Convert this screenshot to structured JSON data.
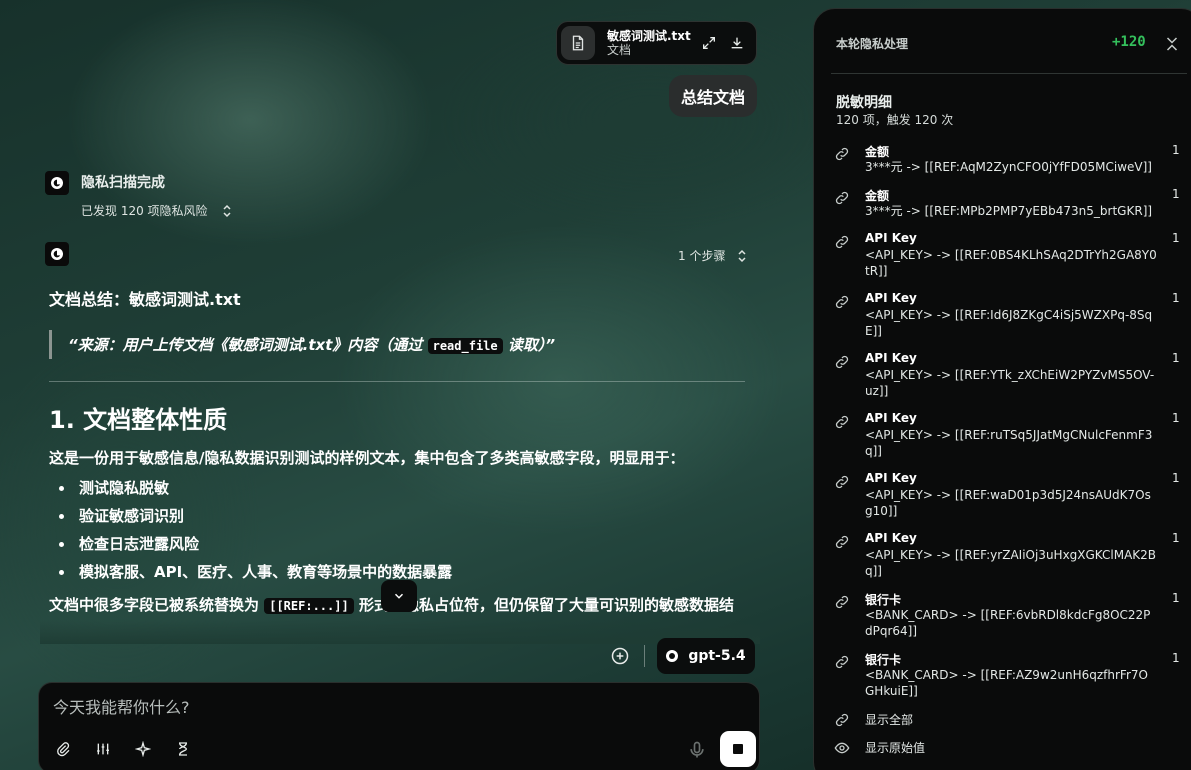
{
  "file": {
    "name": "敏感词测试.txt",
    "type": "文档"
  },
  "user_message": "总结文档",
  "scan": {
    "title": "隐私扫描完成",
    "subtitle": "已发现 120 项隐私风险"
  },
  "steps_label": "1 个步骤",
  "answer": {
    "doc_title": "文档总结：敏感词测试.txt",
    "quote_prefix": "“来源：用户上传文档《敏感词测试.txt》内容（通过 ",
    "quote_code": "read_file",
    "quote_suffix": " 读取）”",
    "heading": "1. 文档整体性质",
    "intro": "这是一份用于敏感信息/隐私数据识别测试的样例文本，集中包含了多类高敏感字段，明显用于：",
    "bullets": [
      "测试隐私脱敏",
      "验证敏感词识别",
      "检查日志泄露风险",
      "模拟客服、API、医疗、人事、教育等场景中的数据暴露"
    ],
    "para2_prefix": "文档中很多字段已被系统替换为 ",
    "para2_code": "[[REF:...]]",
    "para2_suffix": " 形式的隐私占位符，但仍保留了大量可识别的敏感数据结构。"
  },
  "composer": {
    "placeholder": "今天我能帮你什么?",
    "model": "gpt-5.4"
  },
  "panel": {
    "header": "本轮隐私处理",
    "count": "+120",
    "section_title": "脱敏明细",
    "section_sub": "120 项，触发 120 次",
    "items": [
      {
        "label": "金额",
        "value": "3***元 -> [[REF:AqM2ZynCFO0jYfFD05MCiweV]]",
        "count": "1"
      },
      {
        "label": "金额",
        "value": "3***元 -> [[REF:MPb2PMP7yEBb473n5_brtGKR]]",
        "count": "1"
      },
      {
        "label": "API Key",
        "value": "<API_KEY> -> [[REF:0BS4KLhSAq2DTrYh2GA8Y0tR]]",
        "count": "1"
      },
      {
        "label": "API Key",
        "value": "<API_KEY> -> [[REF:Id6J8ZKgC4iSj5WZXPq-8SqE]]",
        "count": "1"
      },
      {
        "label": "API Key",
        "value": "<API_KEY> -> [[REF:YTk_zXChEiW2PYZvMS5OV-uz]]",
        "count": "1"
      },
      {
        "label": "API Key",
        "value": "<API_KEY> -> [[REF:ruTSq5JJatMgCNulcFenmF3q]]",
        "count": "1"
      },
      {
        "label": "API Key",
        "value": "<API_KEY> -> [[REF:waD01p3d5J24nsAUdK7Osg10]]",
        "count": "1"
      },
      {
        "label": "API Key",
        "value": "<API_KEY> -> [[REF:yrZAIiOj3uHxgXGKClMAK2Bq]]",
        "count": "1"
      },
      {
        "label": "银行卡",
        "value": "<BANK_CARD> -> [[REF:6vbRDl8kdcFg8OC22PdPqr64]]",
        "count": "1"
      },
      {
        "label": "银行卡",
        "value": "<BANK_CARD> -> [[REF:AZ9w2unH6qzfhrFr7OGHkuiE]]",
        "count": "1"
      }
    ],
    "show_all": "显示全部",
    "show_original": "显示原始值"
  }
}
